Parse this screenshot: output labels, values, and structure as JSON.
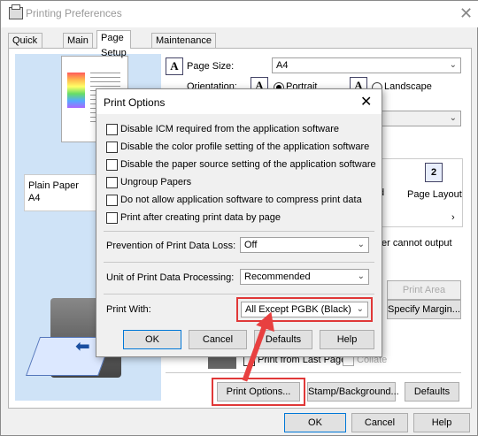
{
  "window": {
    "title": "Printing Preferences"
  },
  "tabs": [
    {
      "label": "Quick Setup"
    },
    {
      "label": "Main"
    },
    {
      "label": "Page Setup"
    },
    {
      "label": "Maintenance"
    }
  ],
  "preview": {
    "media": "Plain Paper",
    "size": "A4"
  },
  "page_setup": {
    "page_size_label": "Page Size:",
    "page_size_value": "A4",
    "orientation_label": "Orientation:",
    "portrait": "Portrait",
    "landscape": "Landscape",
    "page_layout_label": "Page Layout",
    "page_layout_number": "2",
    "partial_d": "d",
    "cannot_output": "er cannot output",
    "print_area_setup": "Print Area Setup...",
    "specify_margin": "Specify Margin...",
    "print_from_last_page": "Print from Last Page",
    "collate": "Collate",
    "print_options_button": "Print Options...",
    "stamp_button": "Stamp/Background...",
    "defaults_button": "Defaults"
  },
  "footer": {
    "ok": "OK",
    "cancel": "Cancel",
    "help": "Help"
  },
  "dialog": {
    "title": "Print Options",
    "checkboxes": [
      {
        "label": "Disable ICM required from the application software"
      },
      {
        "label": "Disable the color profile setting of the application software"
      },
      {
        "label": "Disable the paper source setting of the application software"
      },
      {
        "label": "Ungroup Papers"
      },
      {
        "label": "Do not allow application software to compress print data"
      },
      {
        "label": "Print after creating print data by page"
      }
    ],
    "prevention_label": "Prevention of Print Data Loss:",
    "prevention_value": "Off",
    "unit_label": "Unit of Print Data Processing:",
    "unit_value": "Recommended",
    "print_with_label": "Print With:",
    "print_with_value": "All Except PGBK (Black)",
    "ok": "OK",
    "cancel": "Cancel",
    "defaults": "Defaults",
    "help": "Help"
  },
  "colors": {
    "highlight": "#e03838",
    "accent": "#0078d7"
  }
}
